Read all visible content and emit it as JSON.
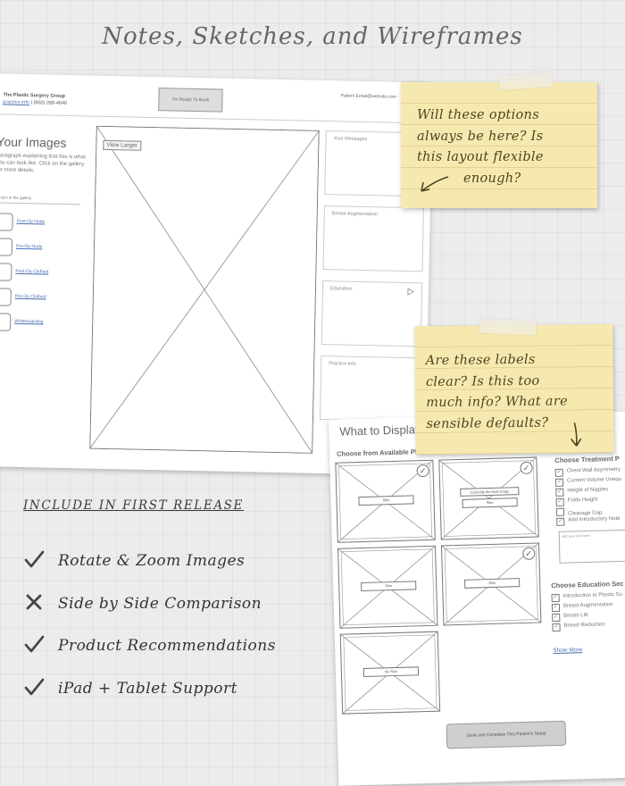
{
  "title": "Notes, Sketches, and Wireframes",
  "wireframe1": {
    "org_name": "The Plastic Surgery Group",
    "org_link": "practice.info",
    "org_sep": "|",
    "org_phone": "(850) 289-4040",
    "book_button": "I'm Ready To Book",
    "patient_email": "Patient Email@website.com",
    "heading": "Your Images",
    "paragraph": "Paragraph explaining that this is what you can look like. Click on the gallery for more details.",
    "gallery_label": "What's in the gallery",
    "gallery_items": [
      "Post-Op Nude",
      "Pre-Op Nude",
      "Post-Op Clothed",
      "Pre-Op Clothed",
      "Whiteboarding"
    ],
    "view_larger": "View Larger",
    "panels": [
      "Your Messages",
      "Breast Augmentation",
      "Education",
      "Practice Info"
    ]
  },
  "note1": {
    "lines": [
      "Will these options",
      "always be here? Is",
      "this layout flexible",
      "enough?"
    ]
  },
  "note2": {
    "lines": [
      "Are these labels",
      "clear? Is this too",
      "much info? What are",
      "sensible defaults?"
    ]
  },
  "wireframe2": {
    "heading": "What to Display",
    "choose_photos": "Choose from Available Photos",
    "thumbs": [
      {
        "label": "Skin",
        "checked": true
      },
      {
        "label": "Skin",
        "label_top": "Currently the lead image",
        "checked": true
      },
      {
        "label": "Skin",
        "checked": false
      },
      {
        "label": "Skin",
        "checked": true
      },
      {
        "label": "No Skin",
        "checked": false
      }
    ],
    "treatment_heading": "Choose Treatment P",
    "treatment_options": [
      {
        "label": "Chest Wall Asymmetry",
        "checked": true
      },
      {
        "label": "Current Volume Unequ",
        "checked": true
      },
      {
        "label": "Height of Nipples",
        "checked": true
      },
      {
        "label": "Folds Height",
        "checked": true
      },
      {
        "label": "Cleavage Gap",
        "checked": false
      },
      {
        "label": "Add Introductory Note",
        "checked": true
      }
    ],
    "textarea_placeholder": "add your text here",
    "education_heading": "Choose Education Sec",
    "education_options": [
      {
        "label": "Introduction to Plastic Su",
        "checked": true
      },
      {
        "label": "Breast Augmentation",
        "checked": true
      },
      {
        "label": "Breast Lift",
        "checked": true
      },
      {
        "label": "Breast Reduction",
        "checked": true
      }
    ],
    "show_more": "Show More",
    "save_button": "Save and Complete This Patient's Setup"
  },
  "release": {
    "heading": "INCLUDE IN FIRST RELEASE",
    "items": [
      {
        "label": "Rotate & Zoom Images",
        "status": "check"
      },
      {
        "label": "Side by Side Comparison",
        "status": "cross"
      },
      {
        "label": "Product Recommendations",
        "status": "check"
      },
      {
        "label": "iPad + Tablet Support",
        "status": "check"
      }
    ]
  }
}
